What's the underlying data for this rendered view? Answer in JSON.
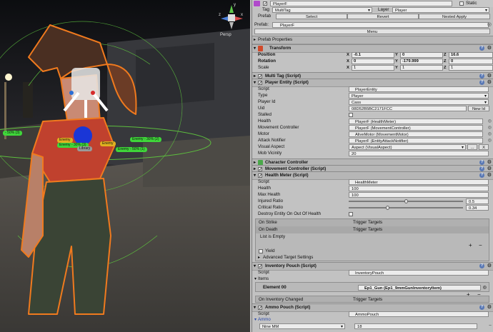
{
  "colors": {
    "selection": "#f07a1e",
    "collider": "#5dbf3e",
    "blue_gizmo": "#1a36d6",
    "tag_green": "#3fd63a",
    "tag_yellow": "#e0b020"
  },
  "scene": {
    "persp_label": "Persp",
    "axes": {
      "y": "y",
      "x": "x",
      "z": "z"
    },
    "enemy_tags": [
      "Enemy",
      "Enemy - 30% (3)",
      "Enemy - 30% (2)",
      "Enemy - 50% (1)",
      "Enemy"
    ],
    "library_tag": "Library",
    "left_tag": "- 50% (3)"
  },
  "header": {
    "object_name": "PlayerF",
    "static_label": "Static",
    "tag_label": "Tag",
    "tag_value": "MultiTag",
    "layer_label": "Layer",
    "layer_value": "Player",
    "prefab_label": "Prefab",
    "select_btn": "Select",
    "revert_btn": "Revert",
    "nested_apply_btn": "Nested Apply",
    "prefab_field_label": "Prefab:",
    "prefab_field_value": "PlayerF",
    "menu_btn": "Menu",
    "prefab_properties": "Prefab Properties"
  },
  "transform": {
    "title": "Transform",
    "position_label": "Position",
    "position": {
      "x": "-0.1",
      "y": "0",
      "z": "16.6"
    },
    "rotation_label": "Rotation",
    "rotation": {
      "x": "0",
      "y": "-179.999",
      "z": "0"
    },
    "scale_label": "Scale",
    "scale": {
      "x": "1",
      "y": "1",
      "z": "1"
    },
    "axis_x": "X",
    "axis_y": "Y",
    "axis_z": "Z"
  },
  "multi_tag": {
    "title": "Multi Tag (Script)"
  },
  "player_entity": {
    "title": "Player Entity (Script)",
    "script_label": "Script",
    "script_value": "PlayerEntity",
    "type_label": "Type",
    "type_value": "Player",
    "player_id_label": "Player Id",
    "player_id_value": "Cass",
    "uid_label": "Uid",
    "uid_value": "08D52B5BC2171FCC",
    "new_id_btn": "New Id",
    "stalled_label": "Stalled",
    "health_label": "Health",
    "health_value": "PlayerF (HealthMeter)",
    "movement_label": "Movement Controller",
    "movement_value": "PlayerF (MovementController)",
    "motor_label": "Motor",
    "motor_value": "AliveMotor (MovementMotor)",
    "attack_label": "Attack Notifier",
    "attack_value": "PlayerF (EntityAttackNotifier)",
    "visual_label": "Visual Aspect",
    "visual_value": "Aspect (VisualAspect)",
    "dots_btn": "...",
    "x_btn": "X",
    "mob_label": "Mob Vicinity",
    "mob_value": "20"
  },
  "character_controller": {
    "title": "Character Controller"
  },
  "movement_controller": {
    "title": "Movement Controller (Script)"
  },
  "health_meter": {
    "title": "Health Meter (Script)",
    "script_label": "Script",
    "script_value": "HealthMeter",
    "health_label": "Health",
    "health_value": "100",
    "max_label": "Max Health",
    "max_value": "100",
    "injured_label": "Injured Ratio",
    "injured_value": "0.5",
    "critical_label": "Critical Ratio",
    "critical_value": "0.34",
    "destroy_label": "Destroy Entity On Out Of Health",
    "on_strike_label": "On Strike",
    "trigger_targets_1": "Trigger Targets",
    "on_death_label": "On Death",
    "trigger_targets_2": "Trigger Targets",
    "list_empty": "List is Empty",
    "yield_label": "Yield",
    "advanced_label": "Advanced Target Settings"
  },
  "inventory_pouch": {
    "title": "Inventory Pouch (Script)",
    "script_label": "Script",
    "script_value": "InventoryPouch",
    "items_label": "Items",
    "element_label": "Element 00",
    "element_value": "Ep1_Gun (Ep1_9mmGunInventoryItem)",
    "on_changed_label": "On Inventory Changed",
    "trigger_targets": "Trigger Targets"
  },
  "ammo_pouch": {
    "title": "Ammo Pouch (Script)",
    "script_label": "Script",
    "script_value": "AmmoPouch",
    "ammo_label": "Ammo",
    "ammo_type": "Nine MM",
    "ammo_value": "18"
  }
}
